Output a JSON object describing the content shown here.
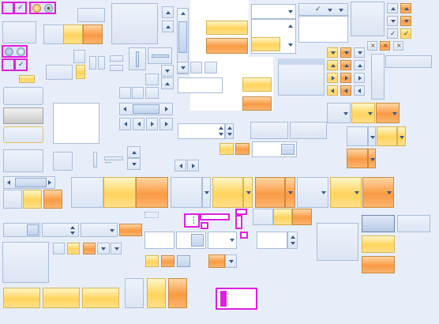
{
  "glyphs": {
    "check": "✓",
    "close": "×",
    "grip": "⋮",
    "dots": "·······"
  }
}
